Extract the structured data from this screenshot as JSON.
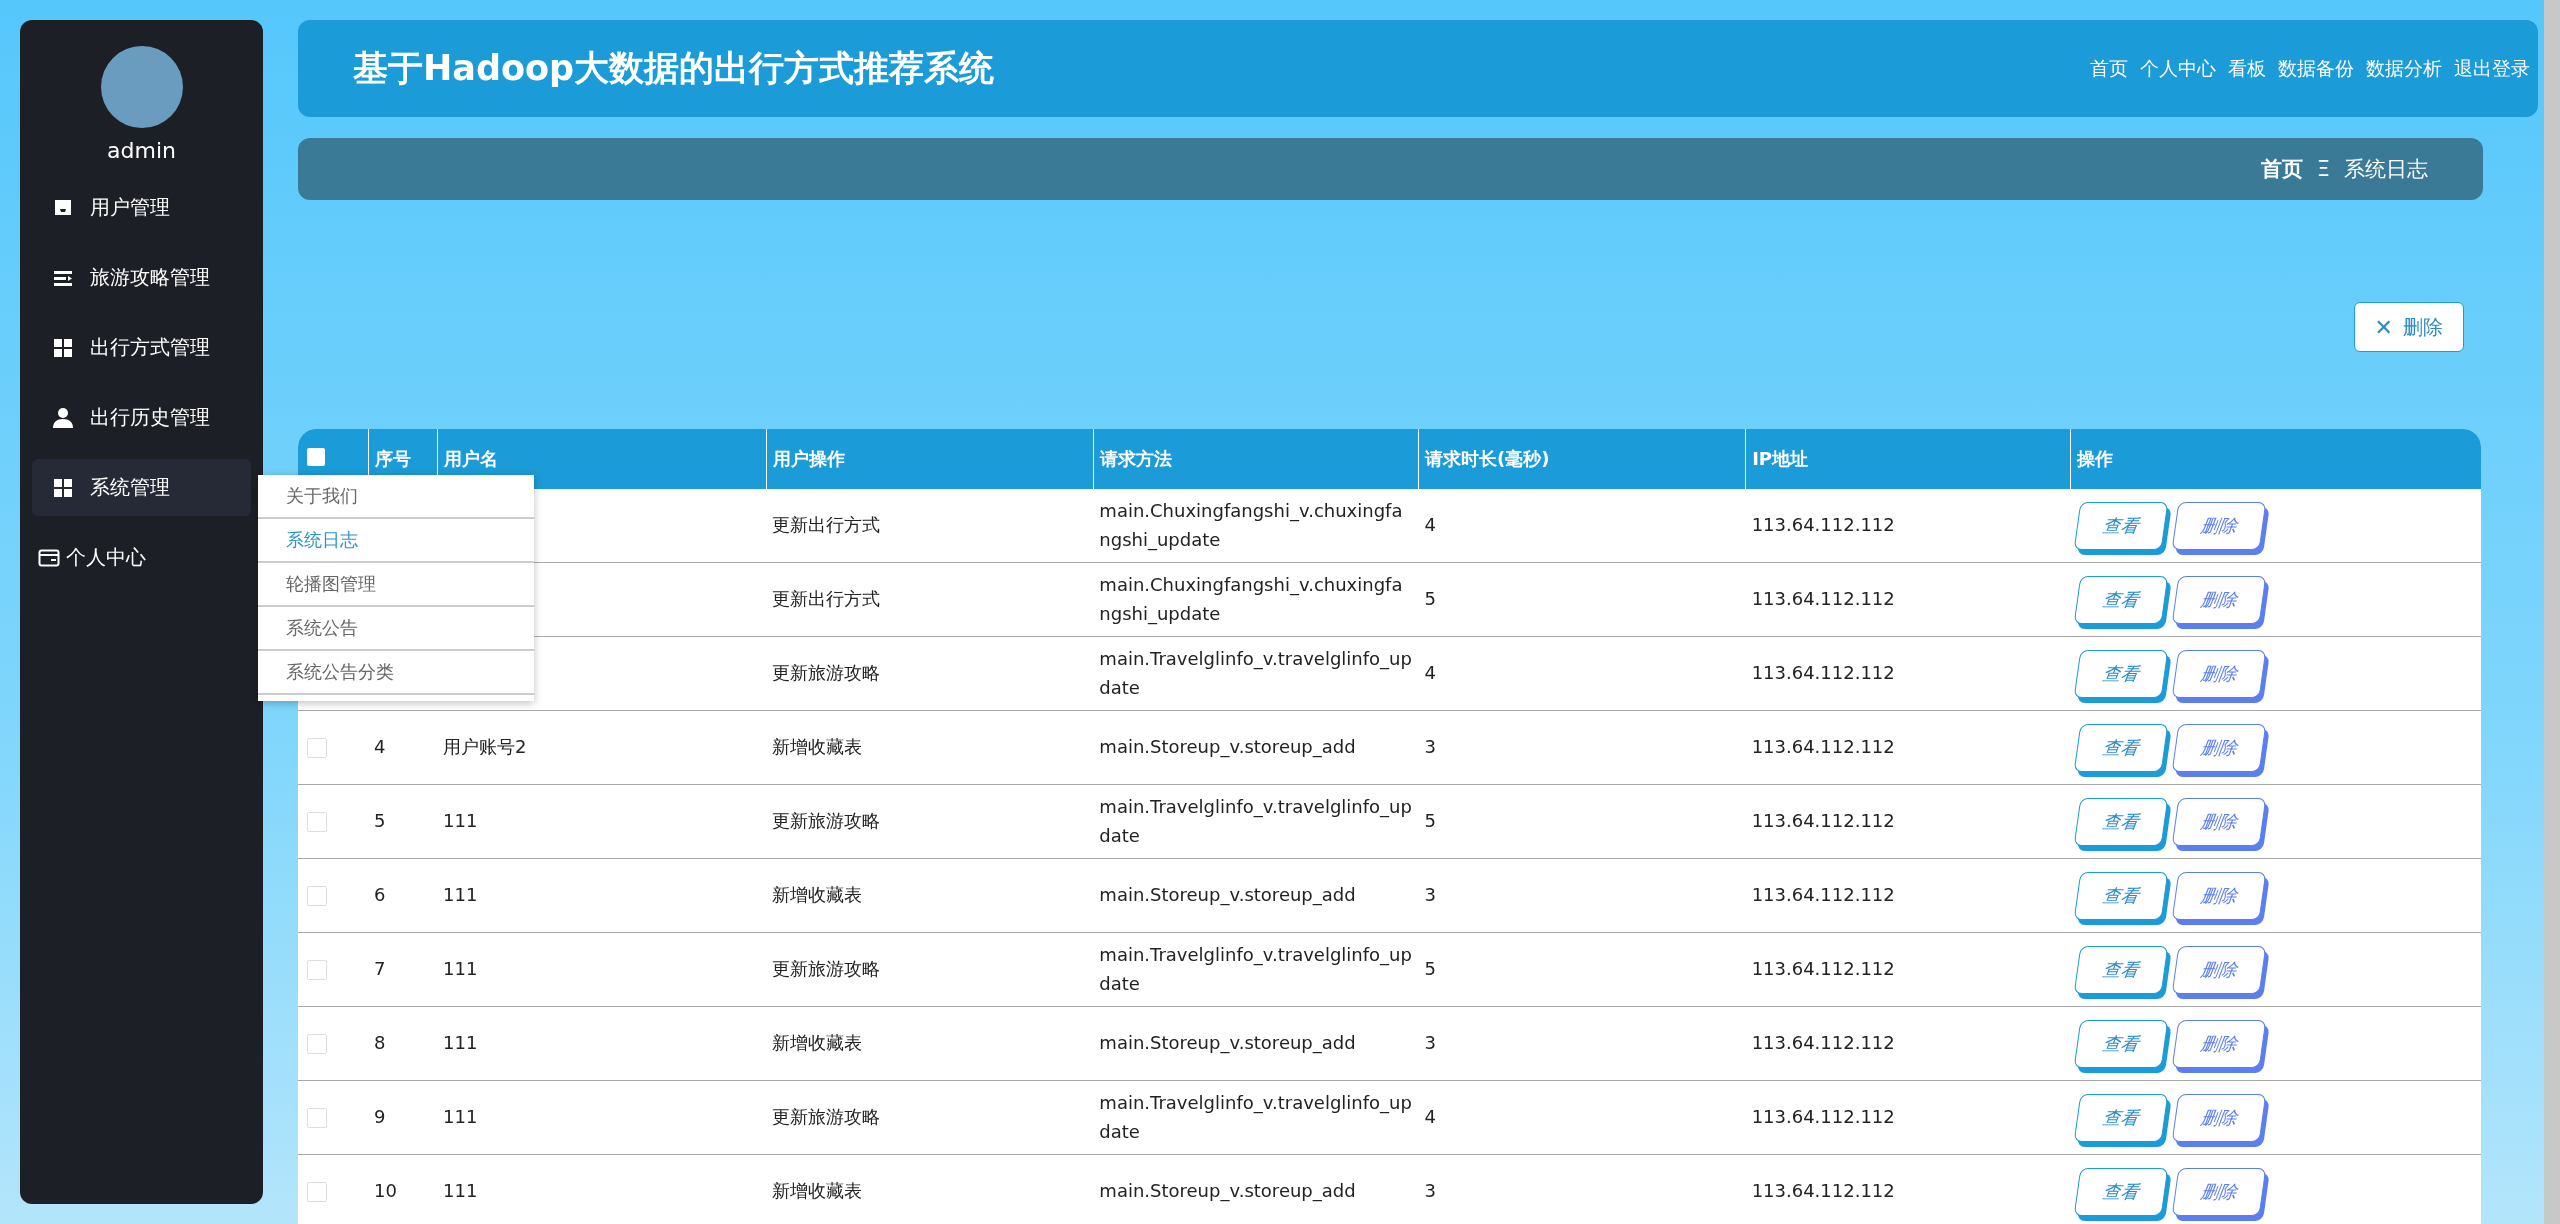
{
  "sidebar": {
    "username": "admin",
    "items": [
      {
        "label": "用户管理",
        "selected": false
      },
      {
        "label": "旅游攻略管理",
        "selected": false
      },
      {
        "label": "出行方式管理",
        "selected": false
      },
      {
        "label": "出行历史管理",
        "selected": false
      },
      {
        "label": "系统管理",
        "selected": true
      },
      {
        "label": "个人中心",
        "selected": false
      }
    ],
    "submenu": [
      {
        "label": "关于我们",
        "selected": false
      },
      {
        "label": "系统日志",
        "selected": true
      },
      {
        "label": "轮播图管理",
        "selected": false
      },
      {
        "label": "系统公告",
        "selected": false
      },
      {
        "label": "系统公告分类",
        "selected": false
      }
    ]
  },
  "header": {
    "title": "基于Hadoop大数据的出行方式推荐系统",
    "nav": [
      "首页",
      "个人中心",
      "看板",
      "数据备份",
      "数据分析",
      "退出登录"
    ]
  },
  "breadcrumb": {
    "home": "首页",
    "separator": "Ξ",
    "current": "系统日志"
  },
  "toolbar": {
    "delete_button": "删除",
    "delete_icon": "✕"
  },
  "table": {
    "all_checked": false,
    "columns": [
      "序号",
      "用户名",
      "用户操作",
      "请求方法",
      "请求时长(毫秒)",
      "IP地址",
      "操作"
    ],
    "rows": [
      {
        "operation": "更新出行方式",
        "method": "main.Chuxingfangshi_v.chuxingfangshi_update",
        "duration": "4",
        "ip": "113.64.112.112",
        "actions": [
          "查看",
          "删除"
        ]
      },
      {
        "operation": "更新出行方式",
        "method": "main.Chuxingfangshi_v.chuxingfangshi_update",
        "duration": "5",
        "ip": "113.64.112.112",
        "actions": [
          "查看",
          "删除"
        ]
      },
      {
        "operation": "更新旅游攻略",
        "method": "main.Travelglinfo_v.travelglinfo_update",
        "duration": "4",
        "ip": "113.64.112.112",
        "actions": [
          "查看",
          "删除"
        ]
      },
      {
        "checked": false,
        "index": "4",
        "user": "用户账号2",
        "operation": "新增收藏表",
        "method": "main.Storeup_v.storeup_add",
        "duration": "3",
        "ip": "113.64.112.112",
        "actions": [
          "查看",
          "删除"
        ]
      },
      {
        "checked": false,
        "index": "5",
        "user": "111",
        "operation": "更新旅游攻略",
        "method": "main.Travelglinfo_v.travelglinfo_update",
        "duration": "5",
        "ip": "113.64.112.112",
        "actions": [
          "查看",
          "删除"
        ]
      },
      {
        "checked": false,
        "index": "6",
        "user": "111",
        "operation": "新增收藏表",
        "method": "main.Storeup_v.storeup_add",
        "duration": "3",
        "ip": "113.64.112.112",
        "actions": [
          "查看",
          "删除"
        ]
      },
      {
        "checked": false,
        "index": "7",
        "user": "111",
        "operation": "更新旅游攻略",
        "method": "main.Travelglinfo_v.travelglinfo_update",
        "duration": "5",
        "ip": "113.64.112.112",
        "actions": [
          "查看",
          "删除"
        ]
      },
      {
        "checked": false,
        "index": "8",
        "user": "111",
        "operation": "新增收藏表",
        "method": "main.Storeup_v.storeup_add",
        "duration": "3",
        "ip": "113.64.112.112",
        "actions": [
          "查看",
          "删除"
        ]
      },
      {
        "checked": false,
        "index": "9",
        "user": "111",
        "operation": "更新旅游攻略",
        "method": "main.Travelglinfo_v.travelglinfo_update",
        "duration": "4",
        "ip": "113.64.112.112",
        "actions": [
          "查看",
          "删除"
        ]
      },
      {
        "checked": false,
        "index": "10",
        "user": "111",
        "operation": "新增收藏表",
        "method": "main.Storeup_v.storeup_add",
        "duration": "3",
        "ip": "113.64.112.112",
        "actions": [
          "查看",
          "删除"
        ]
      }
    ]
  }
}
